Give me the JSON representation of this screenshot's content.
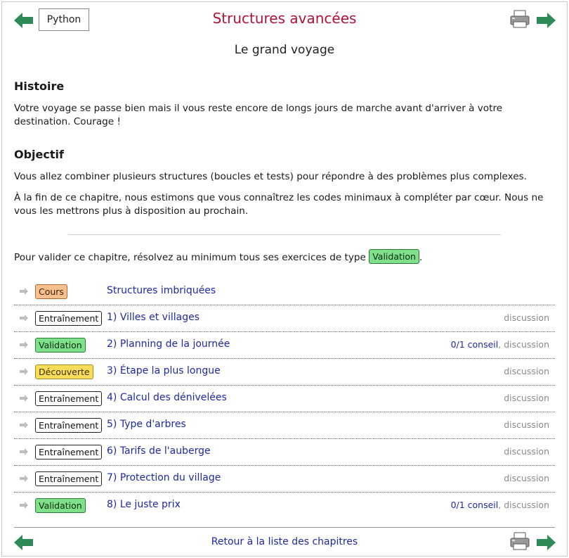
{
  "header": {
    "language_button": "Python",
    "title": "Structures avancées",
    "subtitle": "Le grand voyage"
  },
  "histoire": {
    "heading": "Histoire",
    "text": "Votre voyage se passe bien mais il vous reste encore de longs jours de marche avant d'arriver à votre destination. Courage !"
  },
  "objectif": {
    "heading": "Objectif",
    "text1": "Vous allez combiner plusieurs structures (boucles et tests) pour répondre à des problèmes plus complexes.",
    "text2": "À la fin de ce chapitre, nous estimons que vous connaîtrez les codes minimaux à compléter par cœur. Nous ne vous les mettrons plus à disposition au prochain."
  },
  "validation_note": {
    "before": "Pour valider ce chapitre, résolvez au minimum tous ses exercices de type",
    "badge": "Validation",
    "after": "."
  },
  "exercises": [
    {
      "type": "Cours",
      "kind": "cours",
      "title": "Structures imbriquées",
      "tip": "",
      "sep": "",
      "discussion": ""
    },
    {
      "type": "Entraînement",
      "kind": "entrainement",
      "title": "1) Villes et villages",
      "tip": "",
      "sep": "",
      "discussion": "discussion"
    },
    {
      "type": "Validation",
      "kind": "validation",
      "title": "2) Planning de la journée",
      "tip": "0/1 conseil",
      "sep": ", ",
      "discussion": "discussion"
    },
    {
      "type": "Découverte",
      "kind": "decouverte",
      "title": "3) Étape la plus longue",
      "tip": "",
      "sep": "",
      "discussion": "discussion"
    },
    {
      "type": "Entraînement",
      "kind": "entrainement",
      "title": "4) Calcul des dénivelées",
      "tip": "",
      "sep": "",
      "discussion": "discussion"
    },
    {
      "type": "Entraînement",
      "kind": "entrainement",
      "title": "5) Type d'arbres",
      "tip": "",
      "sep": "",
      "discussion": "discussion"
    },
    {
      "type": "Entraînement",
      "kind": "entrainement",
      "title": "6) Tarifs de l'auberge",
      "tip": "",
      "sep": "",
      "discussion": "discussion"
    },
    {
      "type": "Entraînement",
      "kind": "entrainement",
      "title": "7) Protection du village",
      "tip": "",
      "sep": "",
      "discussion": "discussion"
    },
    {
      "type": "Validation",
      "kind": "validation",
      "title": "8) Le juste prix",
      "tip": "0/1 conseil",
      "sep": ", ",
      "discussion": "discussion"
    }
  ],
  "footer": {
    "back_link": "Retour à la liste des chapitres"
  },
  "colors": {
    "title": "#b01236",
    "link": "#1d2aa6",
    "arrow": "#2e8b57",
    "validation": "#7fe08a",
    "cours": "#f7c08e",
    "decouverte": "#f8dc5a"
  }
}
